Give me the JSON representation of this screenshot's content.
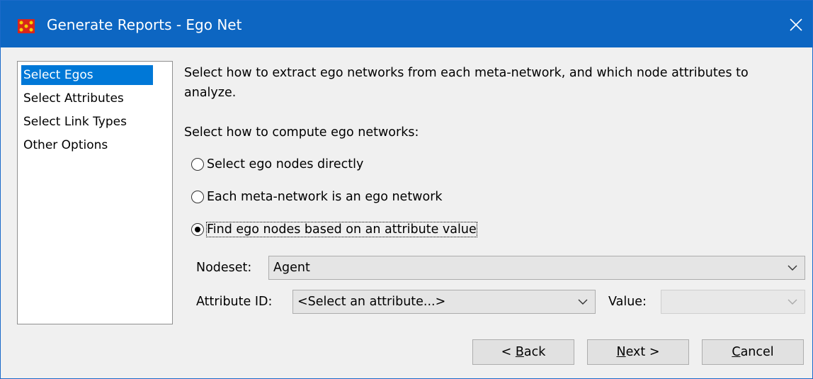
{
  "window": {
    "title": "Generate Reports - Ego Net",
    "close_icon": "close-icon",
    "app_icon": "ora-app-icon"
  },
  "nav": {
    "items": [
      {
        "label": "Select Egos",
        "selected": true
      },
      {
        "label": "Select Attributes",
        "selected": false
      },
      {
        "label": "Select Link Types",
        "selected": false
      },
      {
        "label": "Other Options",
        "selected": false
      }
    ]
  },
  "main": {
    "description": "Select how to extract ego networks from each meta-network, and which node attributes to analyze.",
    "subheading": "Select how to compute ego networks:",
    "options": [
      {
        "label": "Select ego nodes directly",
        "checked": false
      },
      {
        "label": "Each meta-network is an ego network",
        "checked": false
      },
      {
        "label": "Find ego nodes based on an attribute value",
        "checked": true
      }
    ],
    "nodeset_label": "Nodeset:",
    "nodeset_value": "Agent",
    "attribute_label": "Attribute ID:",
    "attribute_value": "<Select an attribute...>",
    "value_label": "Value:",
    "value_value": ""
  },
  "buttons": {
    "back_prefix": "< ",
    "back_mnemonic": "B",
    "back_rest": "ack",
    "next_mnemonic": "N",
    "next_rest": "ext >",
    "cancel_mnemonic": "C",
    "cancel_rest": "ancel"
  },
  "colors": {
    "titlebar": "#0d66c2",
    "selection": "#0078d7"
  }
}
